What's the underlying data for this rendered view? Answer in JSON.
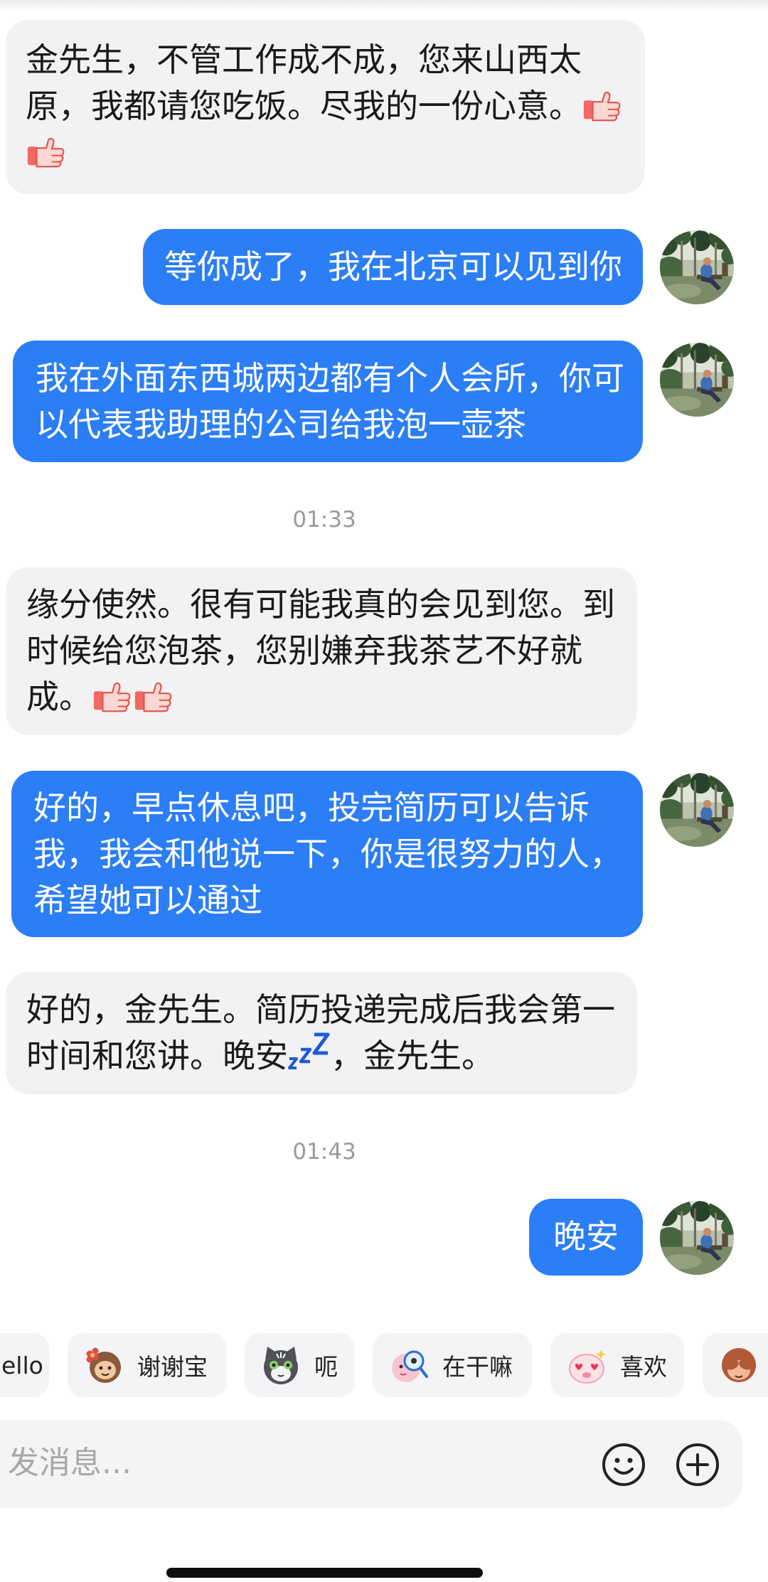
{
  "theme": {
    "sent_bubble": "#2B7EF6",
    "received_bubble": "#F2F2F4",
    "sent_text": "#FFFFFF",
    "received_text": "#1A1A1A",
    "timestamp_text": "#9A9A9A",
    "chip_background": "#F4F4F6"
  },
  "conversation": {
    "messages": [
      {
        "side": "received",
        "lines": [
          "金先生，不管工作成不成，您来山西太",
          "原，我都请您吃饭。尽我的一份心意。"
        ],
        "emojis": [
          "thumbs-up-emoji",
          "thumbs-up-emoji"
        ]
      },
      {
        "side": "sent",
        "lines": [
          "等你成了，我在北京可以见到你"
        ],
        "avatar": "user-avatar"
      },
      {
        "side": "sent",
        "lines": [
          "我在外面东西城两边都有个人会所，你可",
          "以代表我助理的公司给我泡一壶茶"
        ],
        "avatar": "user-avatar"
      },
      {
        "side": "received",
        "lines": [
          "缘分使然。很有可能我真的会见到您。到",
          "时候给您泡茶，您别嫌弃我茶艺不好就",
          "成。"
        ],
        "emojis": [
          "thumbs-up-emoji",
          "thumbs-up-emoji"
        ]
      },
      {
        "side": "sent",
        "lines": [
          "好的，早点休息吧，投完简历可以告诉",
          "我，我会和他说一下，你是很努力的人，",
          "希望她可以通过"
        ],
        "avatar": "user-avatar"
      },
      {
        "side": "received",
        "lines": [
          "好的，金先生。简历投递完成后我会第一",
          "时间和您讲。晚安"
        ],
        "emojis": [
          "sleeping-zzz-emoji"
        ],
        "after_emoji": "，金先生。"
      },
      {
        "side": "sent",
        "lines": [
          "晚安"
        ],
        "avatar": "user-avatar"
      }
    ],
    "timestamps": [
      "01:33",
      "01:43"
    ]
  },
  "quick_replies": [
    {
      "label": "ello"
    },
    {
      "label": "谢谢宝",
      "sticker": "monkey-with-flower-sticker"
    },
    {
      "label": "呃",
      "sticker": "gray-cat-sticker"
    },
    {
      "label": "在干嘛",
      "sticker": "magnifying-glass-sticker"
    },
    {
      "label": "喜欢",
      "sticker": "heart-eyes-sticker"
    },
    {
      "sticker": "monkey-covering-eyes-sticker"
    }
  ],
  "composer": {
    "placeholder": "发消息...",
    "emoji_button_icon": "smiley-icon",
    "attach_button_icon": "plus-circle-icon"
  }
}
